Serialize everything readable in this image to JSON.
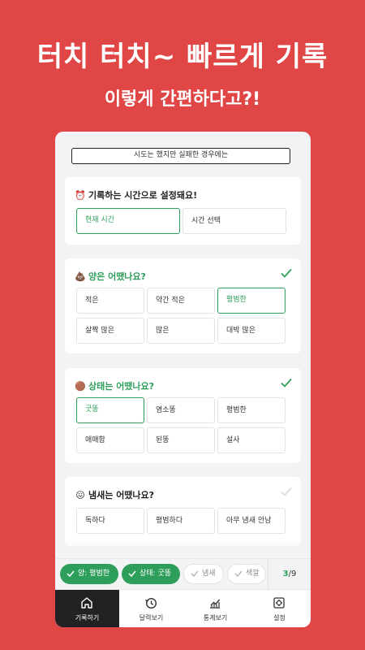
{
  "headline": {
    "title": "터치 터치~ 빠르게 기록",
    "subtitle": "이렇게 간편하다고?!"
  },
  "notice": "시도는 했지만 실패한 경우에는",
  "time_card": {
    "icon": "alarm-clock",
    "title": "기록하는 시간으로 설정돼요!",
    "options": [
      "현재 시간",
      "시간 선택"
    ],
    "selected": "현재 시간"
  },
  "amount_card": {
    "icon": "poop",
    "title": "양은 어땠나요?",
    "done": true,
    "options": [
      "적은",
      "약간 적은",
      "평범한",
      "살짝 많은",
      "많은",
      "대박 많은"
    ],
    "selected": "평범한"
  },
  "state_card": {
    "icon": "poop-pile",
    "title": "상태는 어땠나요?",
    "done": true,
    "options": [
      "굿똥",
      "염소똥",
      "평범한",
      "애매함",
      "된똥",
      "설사"
    ],
    "selected": "굿똥"
  },
  "smell_card": {
    "icon": "pinched-face",
    "title": "냄새는 어땠나요?",
    "done": false,
    "options": [
      "독하다",
      "평범하다",
      "아무 냄새 안남"
    ]
  },
  "chips": [
    {
      "label": "양: 평범한",
      "active": true
    },
    {
      "label": "상태: 굿똥",
      "active": true
    },
    {
      "label": "냄새",
      "active": false
    },
    {
      "label": "색깔",
      "active": false
    }
  ],
  "progress": {
    "current": "3",
    "total": "/9"
  },
  "tabs": [
    {
      "label": "기록하기",
      "icon": "home-icon",
      "active": true
    },
    {
      "label": "달력보기",
      "icon": "history-icon",
      "active": false
    },
    {
      "label": "통계보기",
      "icon": "chart-icon",
      "active": false
    },
    {
      "label": "설정",
      "icon": "gear-icon",
      "active": false
    }
  ],
  "colors": {
    "background": "#E04646",
    "accent": "#2E9E5B",
    "tab_active": "#222222"
  }
}
